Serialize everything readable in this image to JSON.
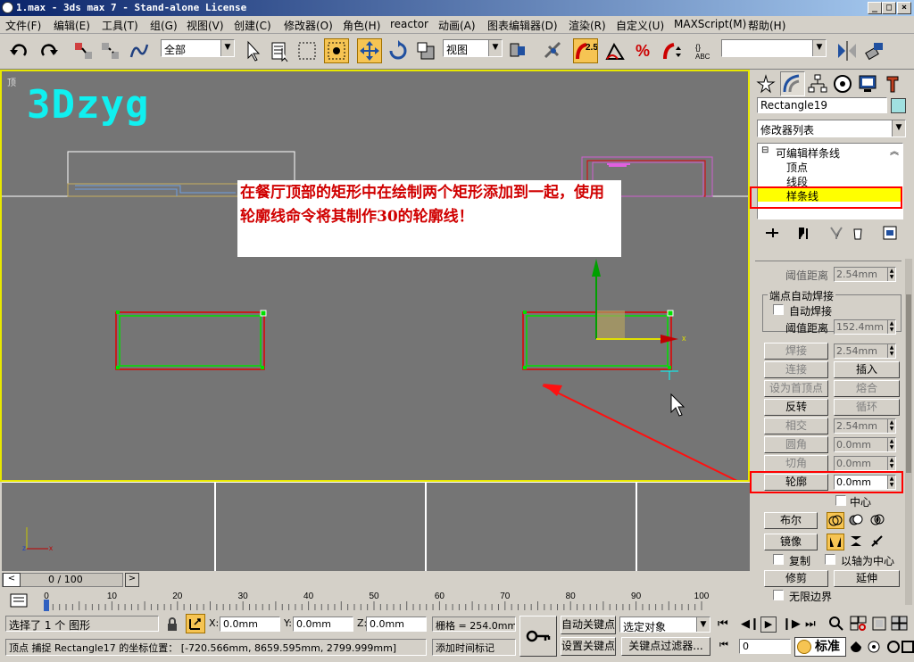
{
  "window": {
    "title": "1.max - 3ds max 7  - Stand-alone License",
    "btn_min": "_",
    "btn_max": "□",
    "btn_close": "×"
  },
  "menu": [
    "文件(F)",
    "编辑(E)",
    "工具(T)",
    "组(G)",
    "视图(V)",
    "创建(C)",
    "修改器(O)",
    "角色(H)",
    "reactor",
    "动画(A)",
    "图表编辑器(D)",
    "渲染(R)",
    "自定义(U)",
    "MAXScript(M)",
    "帮助(H)"
  ],
  "toolbar": {
    "selection_filter": "全部",
    "ref_coord": "视图",
    "snap_value": "2.5",
    "named_selection": ""
  },
  "viewport": {
    "label": "顶",
    "watermark": "3Dzyg",
    "callout": "在餐厅顶部的矩形中在绘制两个矩形添加到一起，使用轮廓线命令将其制作30的轮廓线！",
    "gizmo_x_label": "x"
  },
  "axis": {
    "z": "z",
    "x": "x"
  },
  "command_panel": {
    "object_name": "Rectangle19",
    "modifier_list": "修改器列表",
    "stack": [
      "可编辑样条线",
      "顶点",
      "线段",
      "样条线"
    ],
    "threshold1_label": "阈值距离",
    "threshold1": "2.54mm",
    "endpoint_group": "端点自动焊接",
    "auto_weld": "自动焊接",
    "threshold2_label": "阈值距离",
    "threshold2": "152.4mm",
    "weld": "焊接",
    "weld_val": "2.54mm",
    "connect": "连接",
    "insert": "插入",
    "make_first": "设为首顶点",
    "fuse": "熔合",
    "reverse": "反转",
    "cycle": "循环",
    "intersect": "相交",
    "intersect_val": "2.54mm",
    "fillet": "圆角",
    "fillet_val": "0.0mm",
    "chamfer": "切角",
    "chamfer_val": "0.0mm",
    "outline": "轮廓",
    "outline_val": "0.0mm",
    "center": "中心",
    "boolean": "布尔",
    "mirror": "镜像",
    "copy": "复制",
    "about_pivot": "以轴为中心",
    "trim": "修剪",
    "extend": "延伸",
    "infinite": "无限边界"
  },
  "timeline": {
    "counter": "0 / 100",
    "ticks": [
      "0",
      "10",
      "20",
      "30",
      "40",
      "50",
      "60",
      "70",
      "80",
      "90",
      "100"
    ]
  },
  "status": {
    "selected": "选择了 1 个 图形",
    "x": "0.0mm",
    "y": "0.0mm",
    "z": "0.0mm",
    "grid": "栅格 = 254.0mm",
    "auto_key": "自动关键点",
    "set_key": "设置关键点",
    "sel_set": "选定对象",
    "key_filter": "关键点过滤器...",
    "prompt": "顶点 捕捉 Rectangle17 的坐标位置： [-720.566mm, 8659.595mm, 2799.999mm]",
    "add_time_tag": "添加时间标记",
    "frame": "0",
    "standard": "标准"
  },
  "colors": {
    "viewport_bg": "#757575",
    "active_border": "#e8e800",
    "selection_red": "#e00000",
    "spline_green": "#00e000",
    "watermark": "#10f0f0",
    "highlight_yellow": "#ffff00"
  }
}
